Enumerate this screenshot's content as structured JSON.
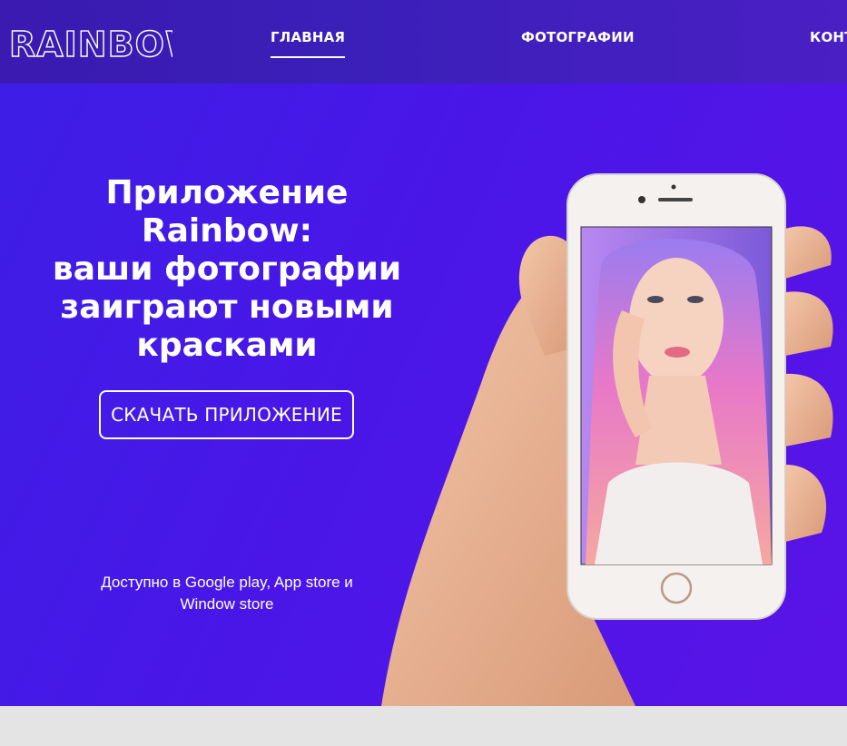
{
  "header": {
    "logo_text": "RAINBOW",
    "nav": [
      {
        "label": "ГЛАВНАЯ",
        "active": true
      },
      {
        "label": "ФОТОГРАФИИ",
        "active": false
      },
      {
        "label": "КОНТАКТЫ",
        "active": false
      }
    ]
  },
  "hero": {
    "headline_lines": [
      "Приложение Rainbow:",
      "ваши фотографии",
      "заиграют новыми",
      "красками"
    ],
    "cta_label": "СКАЧАТЬ ПРИЛОЖЕНИЕ",
    "availability_lines": [
      "Доступно в Google play, App store и",
      "Window store"
    ]
  },
  "colors": {
    "header_bg": "#3a1ab0",
    "hero_bg": "#4a16e8",
    "text": "#ffffff",
    "footer_bg": "#e4e4e4"
  },
  "icons": [
    "logo-wordmark",
    "phone-in-hand-illustration"
  ]
}
